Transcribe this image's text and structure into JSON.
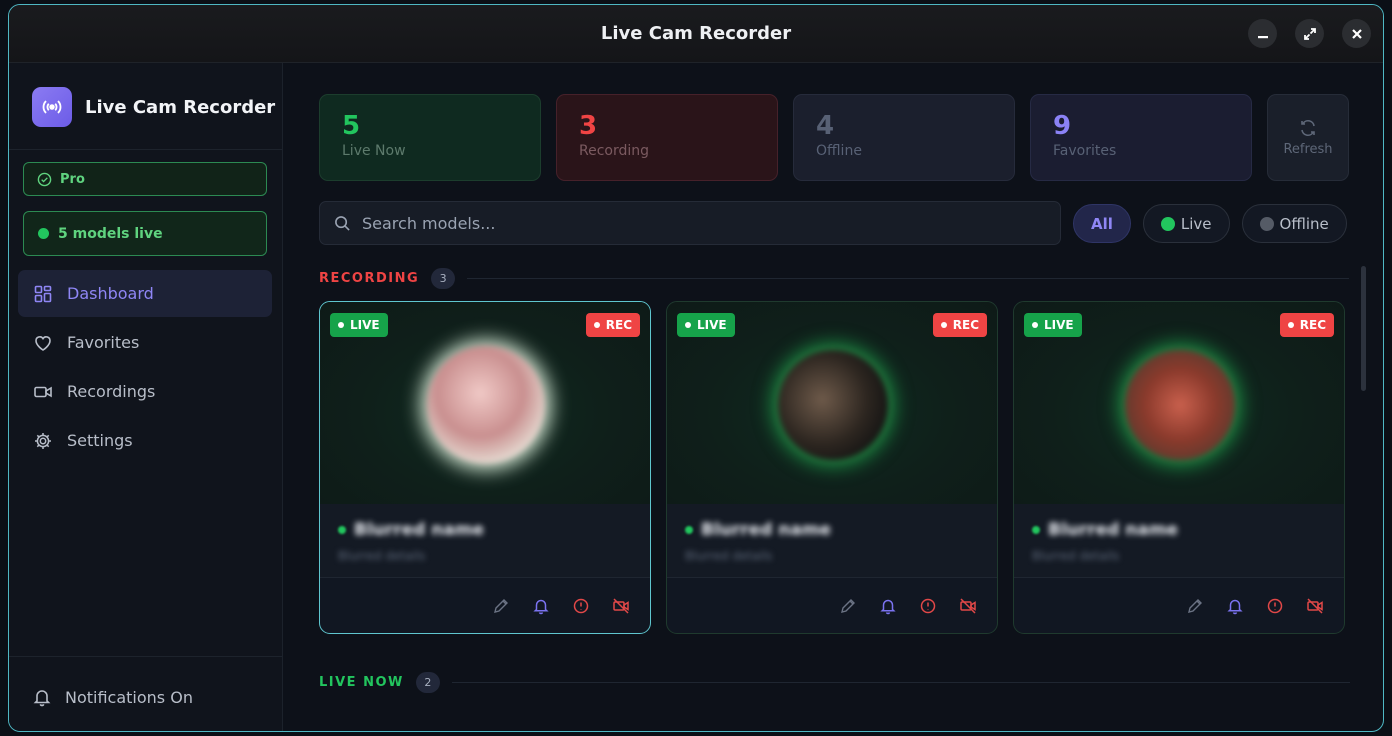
{
  "window": {
    "title": "Live Cam Recorder"
  },
  "sidebar": {
    "brand_name": "Live Cam Recorder",
    "pro_label": "Pro",
    "live_status": "5 models live",
    "nav": [
      {
        "label": "Dashboard",
        "icon": "grid-icon",
        "active": true
      },
      {
        "label": "Favorites",
        "icon": "heart-icon"
      },
      {
        "label": "Recordings",
        "icon": "video-icon"
      },
      {
        "label": "Settings",
        "icon": "gear-icon"
      }
    ],
    "notifications_label": "Notifications On"
  },
  "stats": [
    {
      "value": "5",
      "label": "Live Now",
      "color": "#22c55e"
    },
    {
      "value": "3",
      "label": "Recording",
      "color": "#ef4444"
    },
    {
      "value": "4",
      "label": "Offline",
      "color": "#586175"
    },
    {
      "value": "9",
      "label": "Favorites",
      "color": "#8b82f5"
    }
  ],
  "refresh_label": "Refresh",
  "search": {
    "placeholder": "Search models..."
  },
  "filters": [
    {
      "label": "All",
      "active": true
    },
    {
      "label": "Live",
      "dot_color": "#22c55e"
    },
    {
      "label": "Offline",
      "dot_color": "#555b66"
    }
  ],
  "sections": {
    "recording": {
      "title": "RECORDING",
      "count": "3",
      "color": "#ef4444"
    },
    "live_now": {
      "title": "LIVE NOW",
      "count": "2",
      "color": "#22c55e"
    }
  },
  "cards": [
    {
      "live_label": "LIVE",
      "rec_label": "REC",
      "name": "Blurred name",
      "subtitle": "Blurred details"
    },
    {
      "live_label": "LIVE",
      "rec_label": "REC",
      "name": "Blurred name",
      "subtitle": "Blurred details"
    },
    {
      "live_label": "LIVE",
      "rec_label": "REC",
      "name": "Blurred name",
      "subtitle": "Blurred details"
    }
  ],
  "colors": {
    "accent": "#8f86f5",
    "live_green": "#22c55e",
    "rec_red": "#ef4444",
    "window_border": "#4fb8c4"
  }
}
